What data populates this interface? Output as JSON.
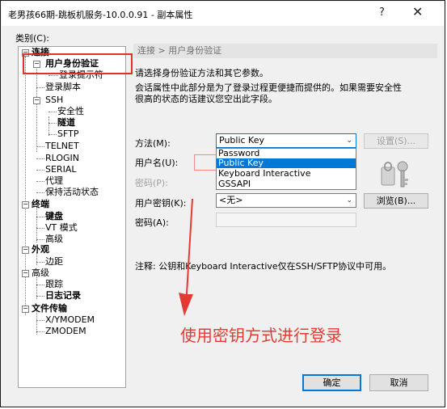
{
  "window": {
    "title": "老男孩66期-跳板机服务-10.0.0.91 - 副本属性",
    "help": "?",
    "close": "✕"
  },
  "category_label": "类别(C):",
  "tree": {
    "connection": "连接",
    "auth": "用户身份验证",
    "login_prompt": "登录提示符",
    "login_script": "登录脚本",
    "ssh": "SSH",
    "security": "安全性",
    "tunnel": "隧道",
    "sftp": "SFTP",
    "telnet": "TELNET",
    "rlogin": "RLOGIN",
    "serial": "SERIAL",
    "proxy": "代理",
    "keepalive": "保持活动状态",
    "terminal": "终端",
    "keyboard": "键盘",
    "vt_mode": "VT 模式",
    "advanced": "高级",
    "appearance": "外观",
    "margin": "边距",
    "advanced2": "高级",
    "trace": "跟踪",
    "logging": "日志记录",
    "file_transfer": "文件传输",
    "xymodem": "X/YMODEM",
    "zmodem": "ZMODEM"
  },
  "breadcrumb": "连接 > 用户身份验证",
  "intro": "请选择身份验证方法和其它参数。",
  "desc_line1": "会话属性中此部分是为了登录过程更便捷而提供的。如果需要安全性",
  "desc_line2": "很高的状态的话建议您空出此字段。",
  "method": {
    "label": "方法(M):",
    "value": "Public Key",
    "options": [
      "Password",
      "Public Key",
      "Keyboard Interactive",
      "GSSAPI"
    ],
    "settings_button": "设置(S)..."
  },
  "username_label": "用户名(U):",
  "password_label": "密码(P):",
  "user_key": {
    "label": "用户密钥(K):",
    "value": "<无>",
    "browse_button": "浏览(B)..."
  },
  "passphrase_label": "密码(A):",
  "note": "注释: 公钥和Keyboard Interactive仅在SSH/SFTP协议中可用。",
  "annotation": "使用密钥方式进行登录",
  "buttons": {
    "ok": "确定",
    "cancel": "取消"
  },
  "colors": {
    "annotation_red": "#e53a34",
    "selection_blue": "#0078d7"
  }
}
